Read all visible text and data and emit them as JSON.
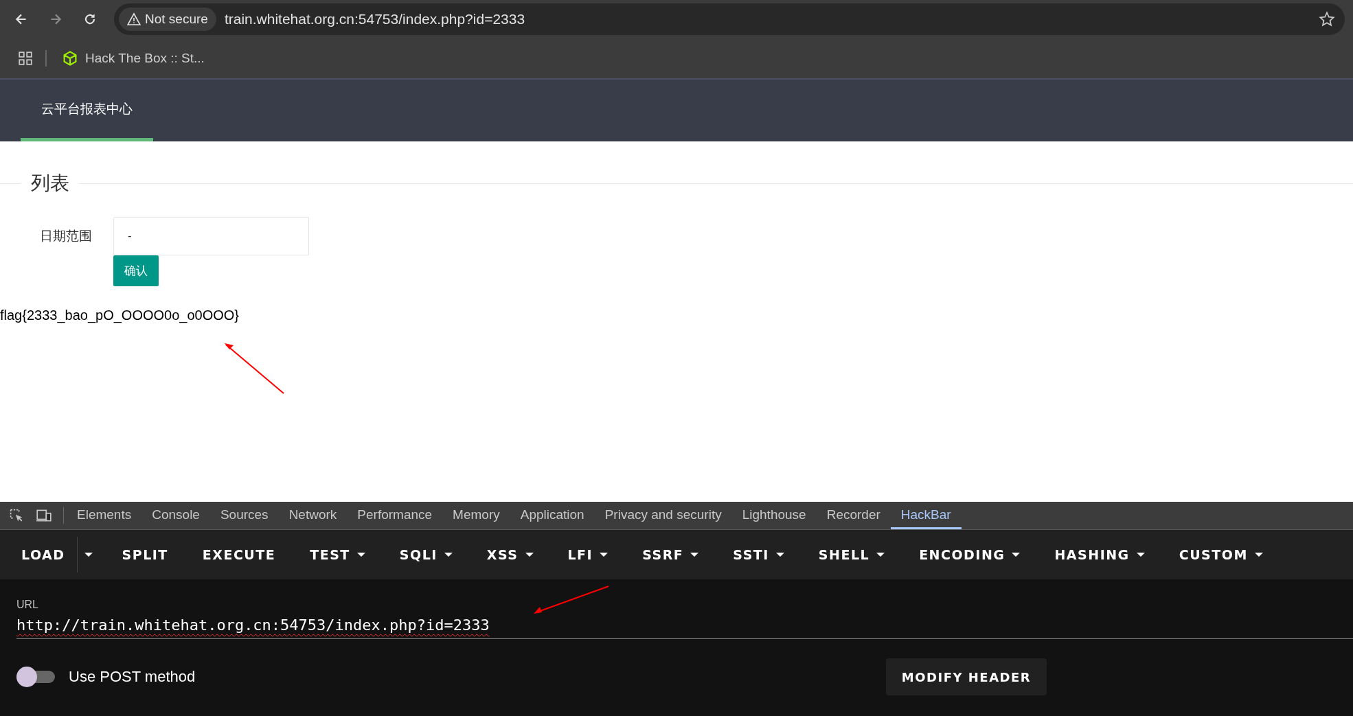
{
  "browser": {
    "security_label": "Not secure",
    "address": "train.whitehat.org.cn:54753/index.php?id=2333",
    "bookmarks": [
      {
        "label": "Hack The Box :: St..."
      }
    ]
  },
  "page": {
    "nav": [
      {
        "label": "云平台报表中心",
        "selected": true
      }
    ],
    "section_title": "列表",
    "form": {
      "label": "日期范围",
      "value": "-",
      "submit": "确认"
    },
    "result": "flag{2333_bao_pO_OOOO0o_o0OOO}"
  },
  "devtools": {
    "tabs": [
      {
        "label": "Elements",
        "selected": false
      },
      {
        "label": "Console",
        "selected": false
      },
      {
        "label": "Sources",
        "selected": false
      },
      {
        "label": "Network",
        "selected": false
      },
      {
        "label": "Performance",
        "selected": false
      },
      {
        "label": "Memory",
        "selected": false
      },
      {
        "label": "Application",
        "selected": false
      },
      {
        "label": "Privacy and security",
        "selected": false
      },
      {
        "label": "Lighthouse",
        "selected": false
      },
      {
        "label": "Recorder",
        "selected": false
      },
      {
        "label": "HackBar",
        "selected": true
      }
    ]
  },
  "hackbar": {
    "toolbar": [
      {
        "label": "LOAD",
        "kind": "split"
      },
      {
        "label": "SPLIT",
        "kind": "button"
      },
      {
        "label": "EXECUTE",
        "kind": "button"
      },
      {
        "label": "TEST",
        "kind": "menu"
      },
      {
        "label": "SQLI",
        "kind": "menu"
      },
      {
        "label": "XSS",
        "kind": "menu"
      },
      {
        "label": "LFI",
        "kind": "menu"
      },
      {
        "label": "SSRF",
        "kind": "menu"
      },
      {
        "label": "SSTI",
        "kind": "menu"
      },
      {
        "label": "SHELL",
        "kind": "menu"
      },
      {
        "label": "ENCODING",
        "kind": "menu"
      },
      {
        "label": "HASHING",
        "kind": "menu"
      },
      {
        "label": "CUSTOM",
        "kind": "menu"
      }
    ],
    "url_label": "URL",
    "url": "http://train.whitehat.org.cn:54753/index.php?id=2333",
    "post_toggle": {
      "label": "Use POST method",
      "on": false
    },
    "modify_header": "MODIFY HEADER"
  }
}
